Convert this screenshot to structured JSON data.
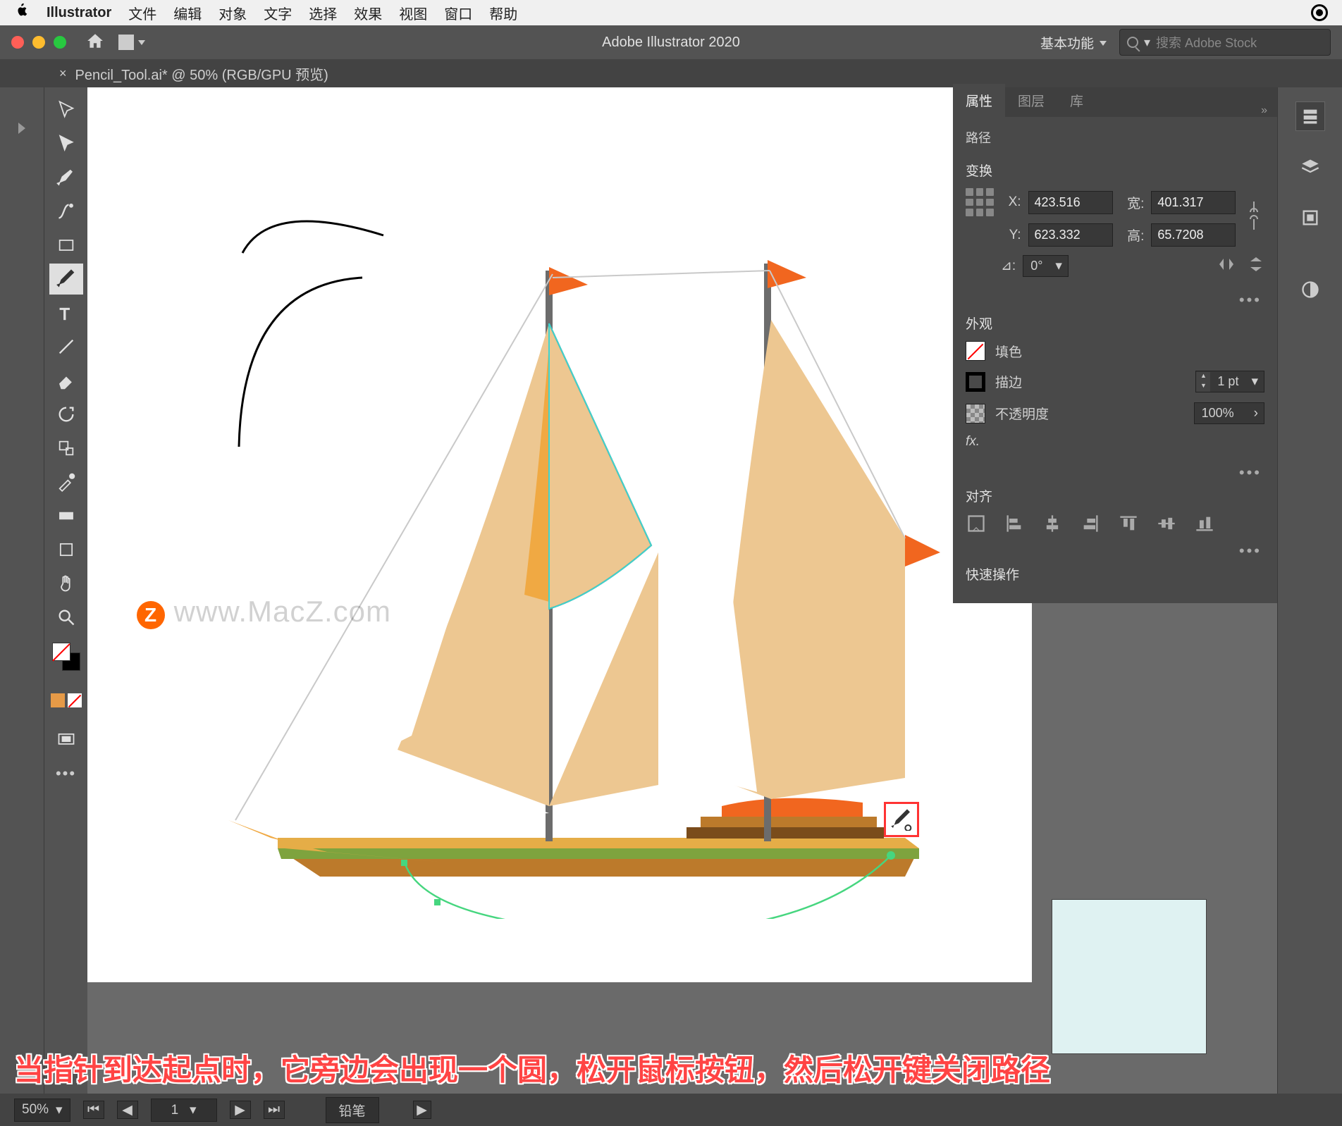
{
  "menubar": {
    "app_name": "Illustrator",
    "items": [
      "文件",
      "编辑",
      "对象",
      "文字",
      "选择",
      "效果",
      "视图",
      "窗口",
      "帮助"
    ]
  },
  "appbar": {
    "title": "Adobe Illustrator 2020",
    "workspace": "基本功能",
    "search_placeholder": "搜索 Adobe Stock"
  },
  "document_tab": {
    "name": "Pencil_Tool.ai* @ 50% (RGB/GPU 预览)"
  },
  "watermark": "www.MacZ.com",
  "props": {
    "tabs": {
      "properties": "属性",
      "layers": "图层",
      "libraries": "库"
    },
    "selection_type": "路径",
    "transform": {
      "title": "变换",
      "x_label": "X:",
      "x_value": "423.516",
      "y_label": "Y:",
      "y_value": "623.332",
      "w_label": "宽:",
      "w_value": "401.317",
      "h_label": "高:",
      "h_value": "65.7208",
      "rotate_label": "⊿:",
      "rotate_value": "0°"
    },
    "appearance": {
      "title": "外观",
      "fill_label": "填色",
      "stroke_label": "描边",
      "stroke_value": "1 pt",
      "opacity_label": "不透明度",
      "opacity_value": "100%",
      "fx_label": "fx."
    },
    "align": {
      "title": "对齐"
    },
    "quick_actions": {
      "title": "快速操作"
    }
  },
  "statusbar": {
    "zoom": "50%",
    "artboard": "1",
    "label": "铅笔"
  },
  "caption": "当指针到达起点时，它旁边会出现一个圆，松开鼠标按钮，然后松开键关闭路径"
}
